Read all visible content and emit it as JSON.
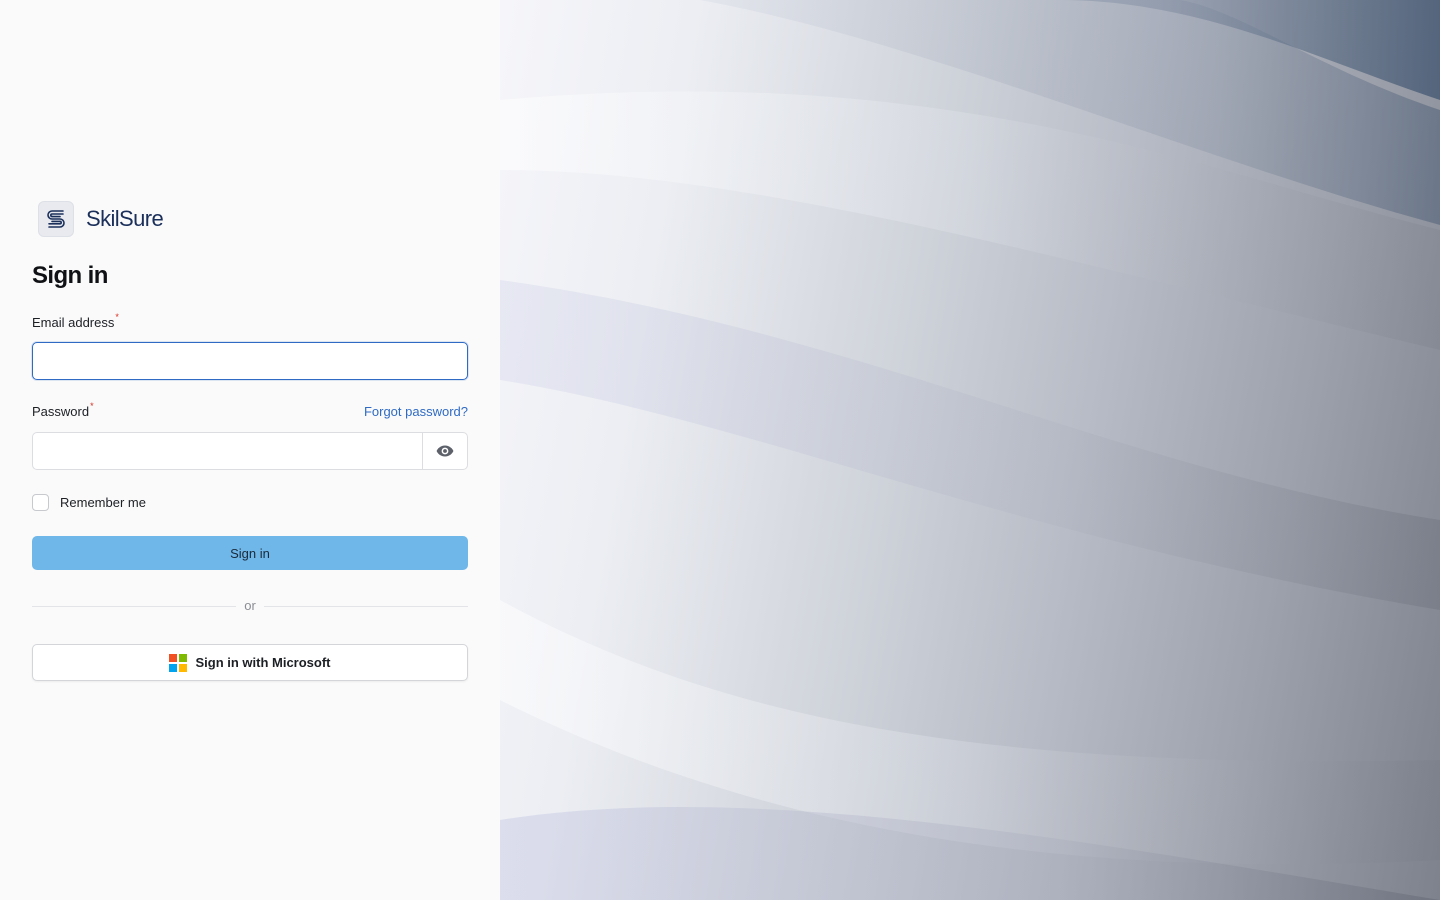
{
  "brand": {
    "name": "SkilSure",
    "logo_icon": "skilsure-logo-icon"
  },
  "form": {
    "title": "Sign in",
    "email": {
      "label": "Email address",
      "required_mark": "*",
      "value": "",
      "placeholder": ""
    },
    "password": {
      "label": "Password",
      "required_mark": "*",
      "value": "",
      "placeholder": "",
      "toggle_icon": "eye-icon"
    },
    "forgot_password_link": "Forgot password?",
    "remember_me_label": "Remember me",
    "remember_me_checked": false,
    "submit_label": "Sign in",
    "divider_text": "or",
    "microsoft_button_label": "Sign in with Microsoft"
  },
  "colors": {
    "accent": "#2f6bc4",
    "primary_button": "#6fb6e9",
    "required": "#d92d20",
    "brand_text": "#1b2f5b",
    "microsoft": [
      "#f25022",
      "#7fba00",
      "#00a4ef",
      "#ffb900"
    ]
  }
}
